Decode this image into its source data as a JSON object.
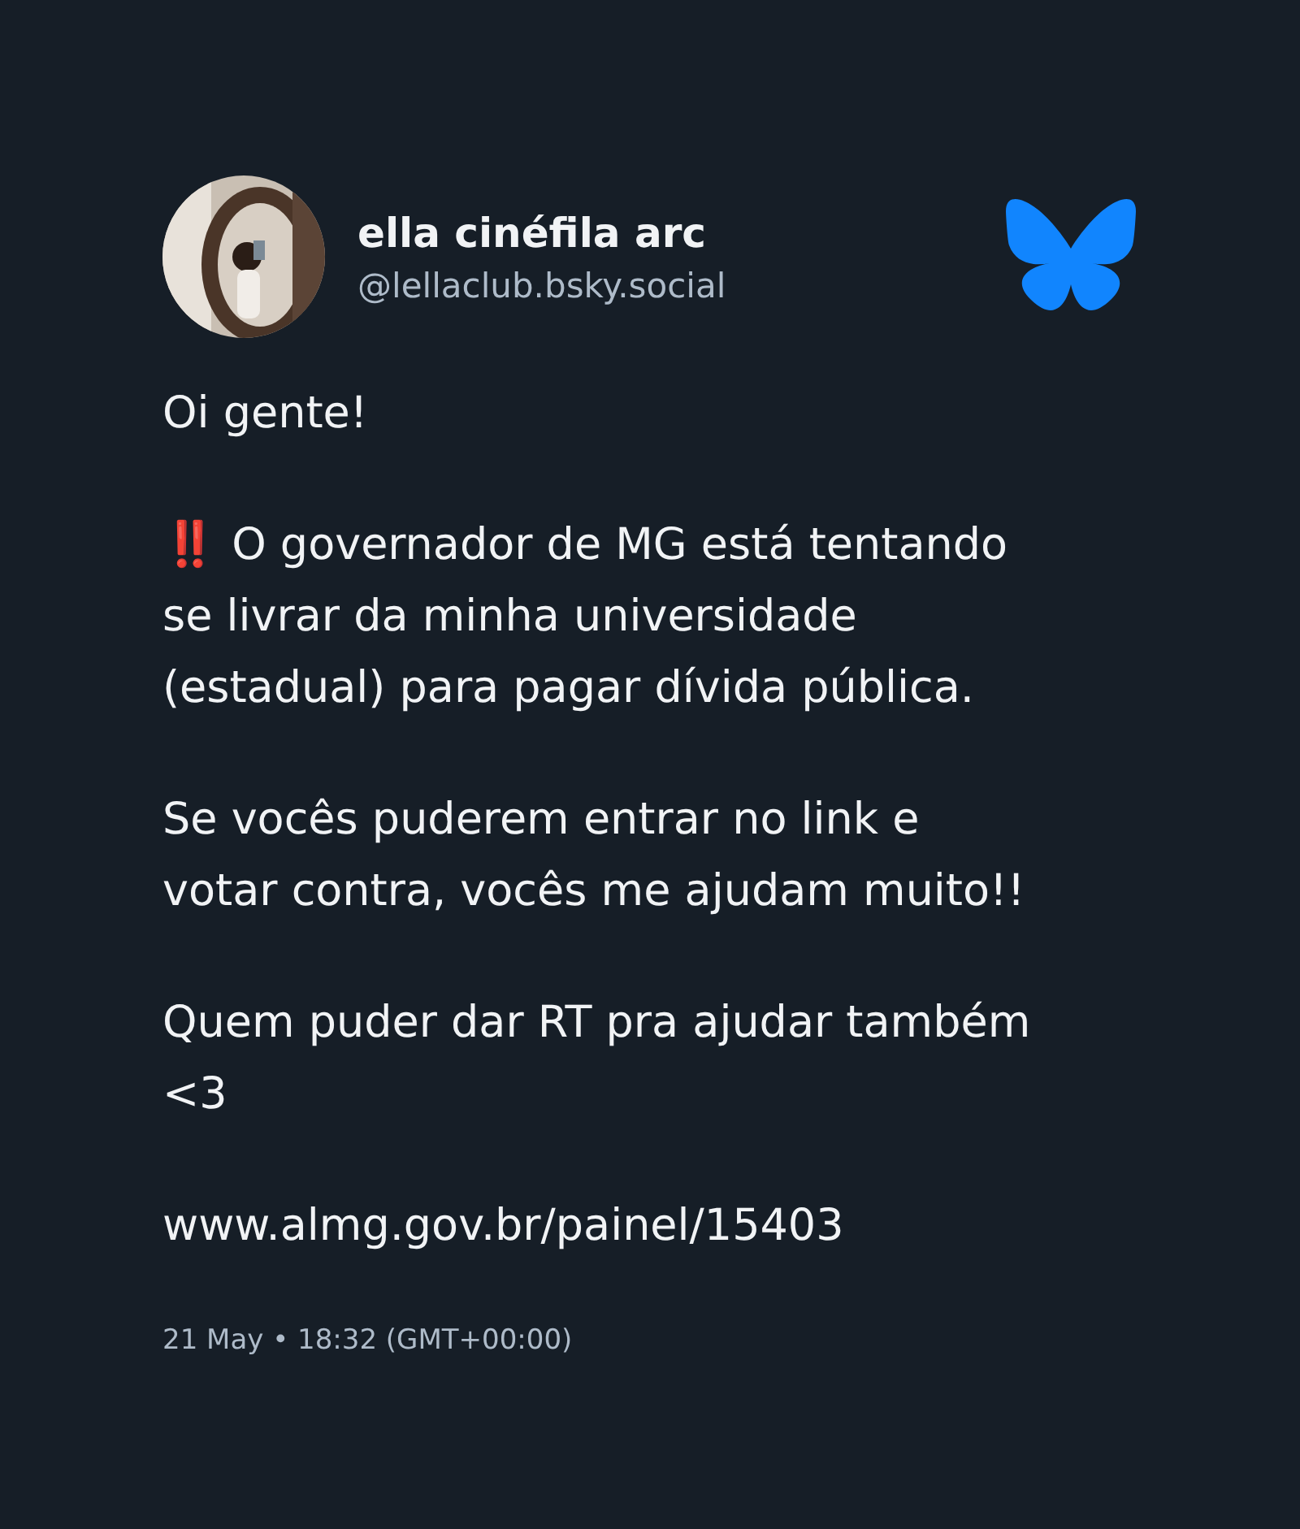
{
  "author": {
    "name": "ella cinéfila arc",
    "handle": "@lellaclub.bsky.social"
  },
  "paragraphs": [
    {
      "lines": [
        "Oi gente!"
      ]
    },
    {
      "emoji": "‼️",
      "lines": [
        "O governador de MG está tentando",
        "se livrar da minha universidade",
        "(estadual) para pagar dívida pública."
      ]
    },
    {
      "lines": [
        "Se vocês puderem entrar no link e",
        "votar contra, vocês me ajudam muito!!"
      ]
    },
    {
      "lines": [
        "Quem puder dar RT pra ajudar também",
        "<3"
      ]
    },
    {
      "lines": [
        "www.almg.gov.br/painel/15403"
      ]
    }
  ],
  "timestamp": "21 May • 18:32 (GMT+00:00)"
}
